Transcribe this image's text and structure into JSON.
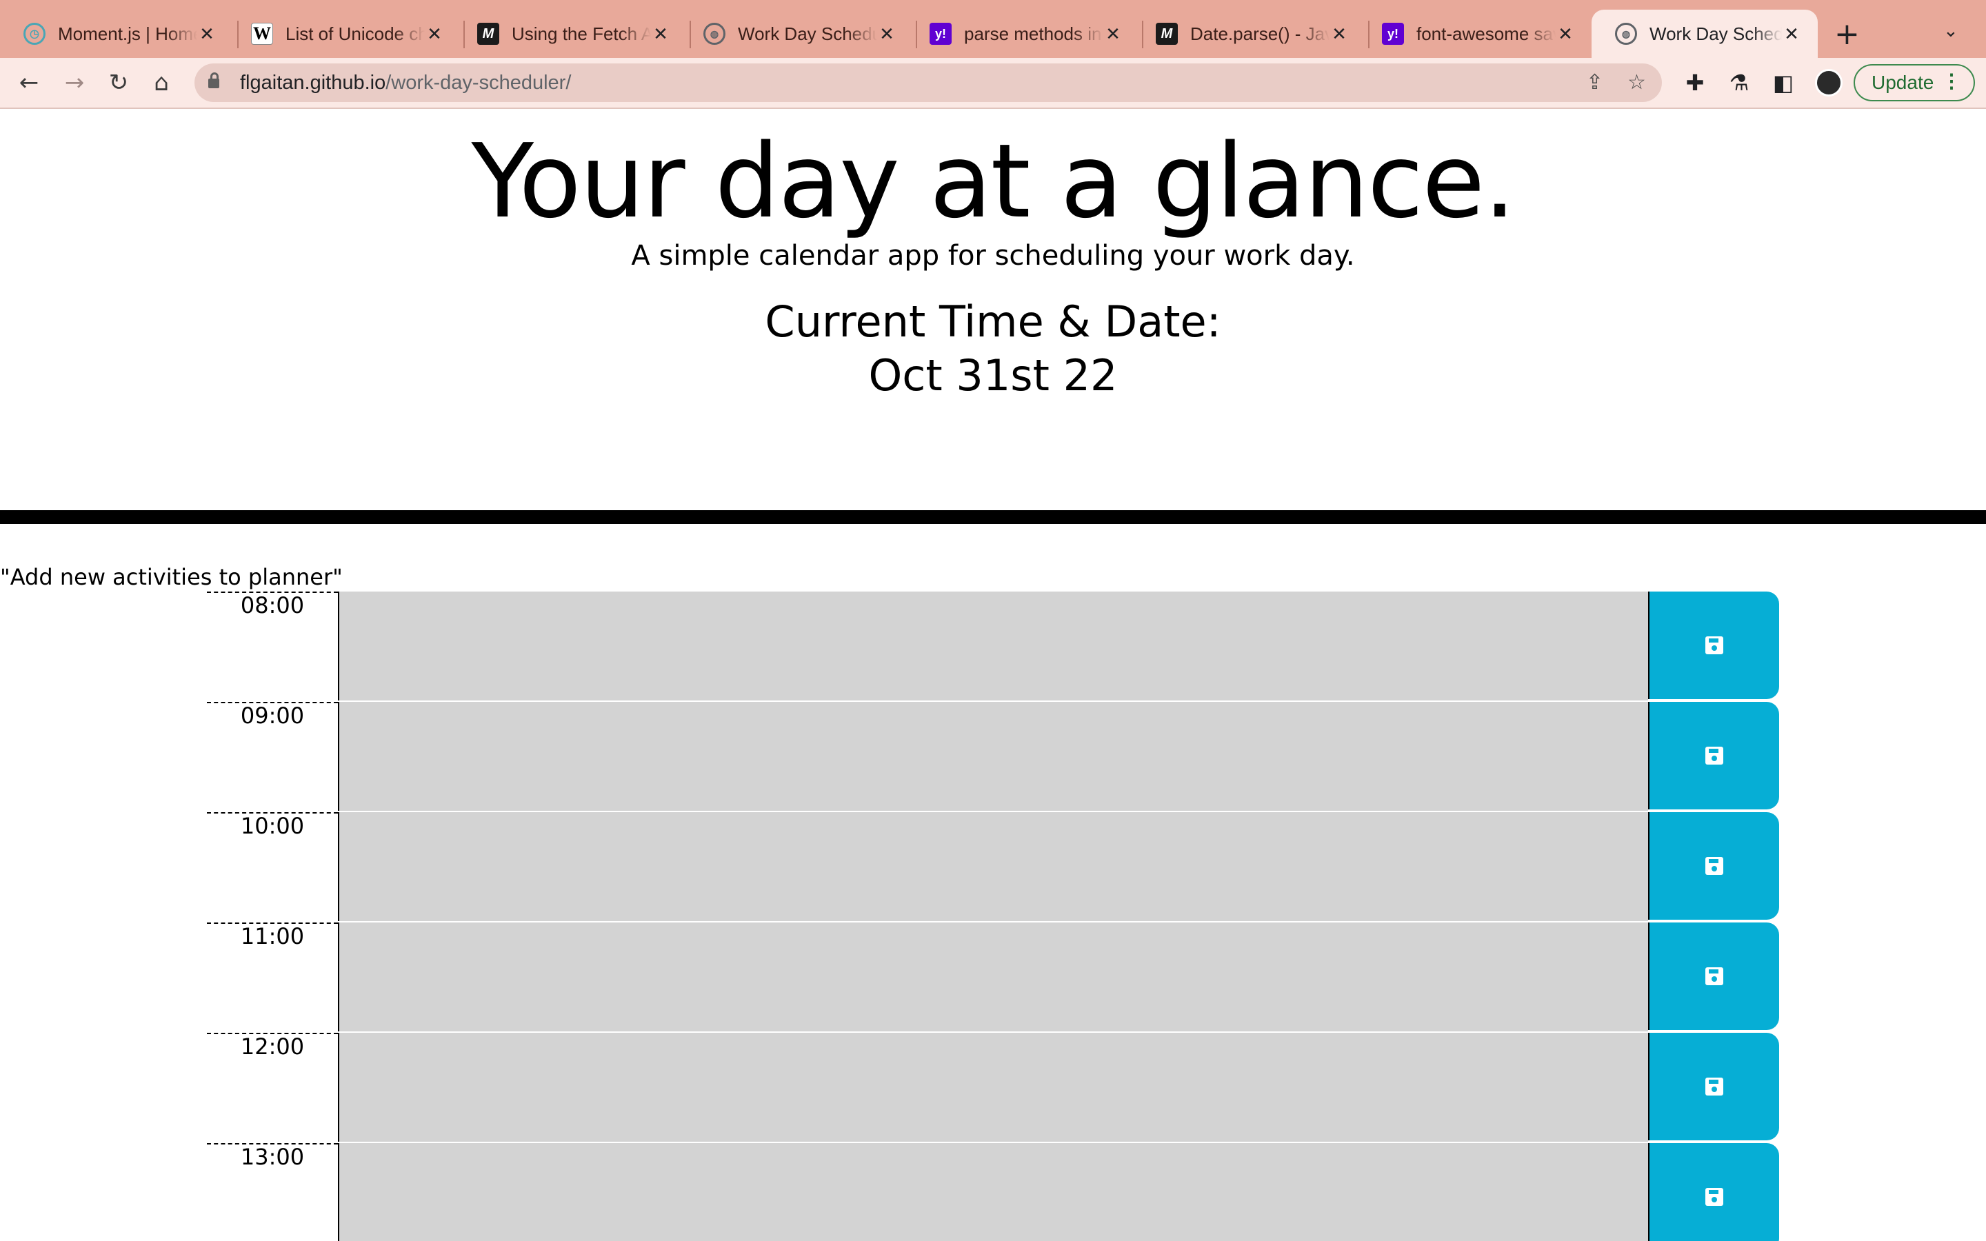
{
  "browser": {
    "tabs": [
      {
        "title": "Moment.js | Home",
        "icon": "clock-icon",
        "active": false
      },
      {
        "title": "List of Unicode characters",
        "icon": "wikipedia-icon",
        "active": false
      },
      {
        "title": "Using the Fetch API",
        "icon": "mdn-icon",
        "active": false
      },
      {
        "title": "Work Day Scheduler",
        "icon": "globe-icon",
        "active": false
      },
      {
        "title": "parse methods in",
        "icon": "yahoo-icon",
        "active": false
      },
      {
        "title": "Date.parse() - JavaScript",
        "icon": "mdn-icon",
        "active": false
      },
      {
        "title": "font-awesome save",
        "icon": "yahoo-icon",
        "active": false
      },
      {
        "title": "Work Day Scheduler",
        "icon": "globe-icon",
        "active": true
      }
    ],
    "url_host": "flgaitan.github.io",
    "url_path": "/work-day-scheduler/",
    "update_label": "Update",
    "accent_color": "#e8a99a"
  },
  "page": {
    "title": "Your day at a glance.",
    "subtitle": "A simple calendar app for scheduling your work day.",
    "time_label": "Current Time & Date:",
    "time_value": "Oct 31st 22",
    "add_label": "\"Add new activities to planner\"",
    "save_color": "#06aed5",
    "hours": [
      {
        "time": "08:00",
        "text": ""
      },
      {
        "time": "09:00",
        "text": ""
      },
      {
        "time": "10:00",
        "text": ""
      },
      {
        "time": "11:00",
        "text": ""
      },
      {
        "time": "12:00",
        "text": ""
      },
      {
        "time": "13:00",
        "text": ""
      }
    ]
  }
}
